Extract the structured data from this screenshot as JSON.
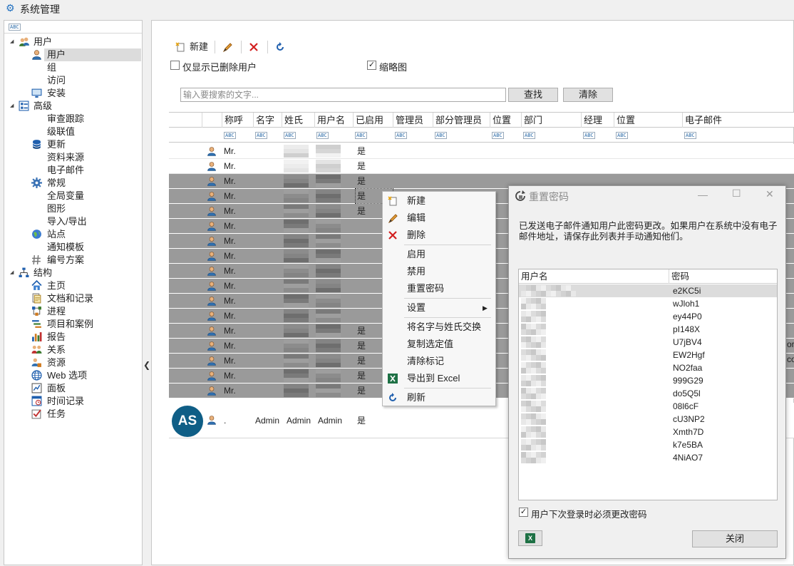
{
  "window": {
    "title": "系统管理"
  },
  "sidebar": {
    "items": [
      {
        "label": "用户",
        "level": 0,
        "icon": "users-icon"
      },
      {
        "label": "用户",
        "level": 1,
        "icon": "user-icon"
      },
      {
        "label": "组",
        "level": 1,
        "icon": ""
      },
      {
        "label": "访问",
        "level": 1,
        "icon": ""
      },
      {
        "label": "安装",
        "level": 1,
        "icon": "monitor-icon"
      },
      {
        "label": "高级",
        "level": 0,
        "icon": "advanced-icon"
      },
      {
        "label": "审查跟踪",
        "level": 1,
        "icon": ""
      },
      {
        "label": "级联值",
        "level": 1,
        "icon": ""
      },
      {
        "label": "更新",
        "level": 1,
        "icon": "database-icon"
      },
      {
        "label": "资料来源",
        "level": 1,
        "icon": ""
      },
      {
        "label": "电子邮件",
        "level": 1,
        "icon": ""
      },
      {
        "label": "常规",
        "level": 1,
        "icon": "gear-icon"
      },
      {
        "label": "全局变量",
        "level": 1,
        "icon": ""
      },
      {
        "label": "图形",
        "level": 1,
        "icon": ""
      },
      {
        "label": "导入/导出",
        "level": 1,
        "icon": ""
      },
      {
        "label": "站点",
        "level": 1,
        "icon": "globe-icon"
      },
      {
        "label": "通知模板",
        "level": 1,
        "icon": ""
      },
      {
        "label": "编号方案",
        "level": 1,
        "icon": "numbering-icon"
      },
      {
        "label": "结构",
        "level": 0,
        "icon": "structure-icon"
      },
      {
        "label": "主页",
        "level": 1,
        "icon": "home-icon"
      },
      {
        "label": "文档和记录",
        "level": 1,
        "icon": "documents-icon"
      },
      {
        "label": "进程",
        "level": 1,
        "icon": "process-icon"
      },
      {
        "label": "项目和案例",
        "level": 1,
        "icon": "projects-icon"
      },
      {
        "label": "报告",
        "level": 1,
        "icon": "report-icon"
      },
      {
        "label": "关系",
        "level": 1,
        "icon": "relations-icon"
      },
      {
        "label": "资源",
        "level": 1,
        "icon": "resources-icon"
      },
      {
        "label": "Web 选项",
        "level": 1,
        "icon": "web-icon"
      },
      {
        "label": "面板",
        "level": 1,
        "icon": "panel-icon"
      },
      {
        "label": "时间记录",
        "level": 1,
        "icon": "time-icon"
      },
      {
        "label": "任务",
        "level": 1,
        "icon": "task-icon"
      }
    ]
  },
  "toolbar": {
    "new_label": "新建",
    "show_deleted_label": "仅显示已删除用户",
    "thumbnail_label": "缩略图"
  },
  "search": {
    "placeholder": "输入要搜索的文字...",
    "find_label": "查找",
    "clear_label": "清除"
  },
  "grid": {
    "columns": [
      "称呼",
      "名字",
      "姓氏",
      "用户名",
      "已启用",
      "管理员",
      "部分管理员",
      "位置",
      "部门",
      "经理",
      "位置",
      "电子邮件"
    ],
    "rows": [
      {
        "title": "Mr.",
        "enabled": "是"
      },
      {
        "title": "Mr.",
        "enabled": "是"
      },
      {
        "title": "Mr.",
        "enabled": "是"
      },
      {
        "title": "Mr.",
        "enabled": "是"
      },
      {
        "title": "Mr.",
        "enabled": "是"
      },
      {
        "title": "Mr.",
        "enabled": ""
      },
      {
        "title": "Mr.",
        "enabled": ""
      },
      {
        "title": "Mr.",
        "enabled": ""
      },
      {
        "title": "Mr.",
        "enabled": ""
      },
      {
        "title": "Mr.",
        "enabled": ""
      },
      {
        "title": "Mr.",
        "enabled": ""
      },
      {
        "title": "Mr.",
        "enabled": ""
      },
      {
        "title": "Mr.",
        "enabled": "是"
      },
      {
        "title": "Mr.",
        "enabled": "是"
      },
      {
        "title": "Mr.",
        "enabled": "是"
      },
      {
        "title": "Mr.",
        "enabled": "是"
      },
      {
        "title": "Mr.",
        "enabled": "是"
      }
    ],
    "admin_row": {
      "avatar": "AS",
      "title": ".",
      "first": "Admin",
      "last": "Admin",
      "username": "Admin",
      "enabled": "是"
    }
  },
  "context_menu": {
    "items": [
      {
        "label": "新建",
        "icon": "new-icon"
      },
      {
        "label": "编辑",
        "icon": "edit-icon"
      },
      {
        "label": "删除",
        "icon": "delete-icon"
      },
      {
        "label": "启用",
        "icon": ""
      },
      {
        "label": "禁用",
        "icon": ""
      },
      {
        "label": "重置密码",
        "icon": ""
      },
      {
        "label": "设置",
        "icon": "",
        "submenu": true
      },
      {
        "label": "将名字与姓氏交换",
        "icon": ""
      },
      {
        "label": "复制选定值",
        "icon": ""
      },
      {
        "label": "清除标记",
        "icon": ""
      },
      {
        "label": "导出到 Excel",
        "icon": "excel-icon"
      },
      {
        "label": "刷新",
        "icon": "refresh-icon"
      }
    ]
  },
  "dialog": {
    "title": "重置密码",
    "message": "已发送电子邮件通知用户此密码更改。如果用户在系统中没有电子邮件地址，请保存此列表并手动通知他们。",
    "col_username": "用户名",
    "col_password": "密码",
    "passwords": [
      "e2KC5i",
      "wJloh1",
      "ey44P0",
      "pI148X",
      "U7jBV4",
      "EW2Hgf",
      "NO2faa",
      "999G29",
      "do5Q5l",
      "08l6cF",
      "cU3NP2",
      "Xmth7D",
      "k7e5BA",
      "4NiAO7"
    ],
    "must_change_label": "用户下次登录时必须更改密码",
    "close_label": "关闭"
  },
  "edge_text": [
    "or",
    "co"
  ]
}
